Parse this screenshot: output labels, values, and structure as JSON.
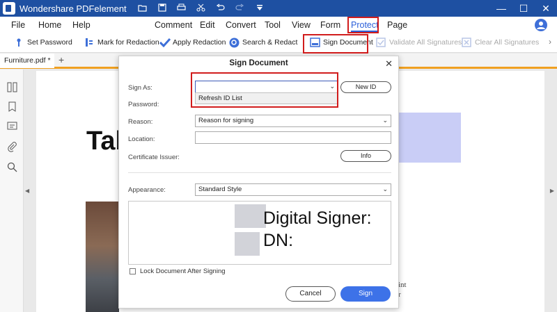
{
  "app": {
    "title": "Wondershare PDFelement"
  },
  "menu": {
    "file": "File",
    "home": "Home",
    "help": "Help",
    "comment": "Comment",
    "edit": "Edit",
    "convert": "Convert",
    "tool": "Tool",
    "view": "View",
    "form": "Form",
    "protect": "Protect",
    "page": "Page"
  },
  "toolbar": {
    "set_password": "Set Password",
    "mark_for_redaction": "Mark for Redaction",
    "apply_redaction": "Apply Redaction",
    "search_redact": "Search & Redact",
    "sign_document": "Sign Document",
    "validate_all": "Validate All Signatures",
    "clear_all": "Clear All Signatures"
  },
  "tab": {
    "name": "Furniture.pdf *",
    "add": "+"
  },
  "document": {
    "heading": "Tab",
    "text_line1": "int",
    "text_line2": "r"
  },
  "dialog": {
    "title": "Sign Document",
    "sign_as_label": "Sign As:",
    "sign_as_value": "",
    "dropdown_option": "Refresh ID List",
    "new_id": "New ID",
    "password_label": "Password:",
    "reason_label": "Reason:",
    "reason_value": "Reason for signing",
    "location_label": "Location:",
    "location_value": "",
    "cert_issuer_label": "Certificate Issuer:",
    "info": "Info",
    "appearance_label": "Appearance:",
    "appearance_value": "Standard Style",
    "preview_line1": "Digital Signer:",
    "preview_line2": "DN:",
    "lock_label": "Lock Document After Signing",
    "cancel": "Cancel",
    "sign": "Sign"
  },
  "colors": {
    "accent": "#3d72e8",
    "titlebar": "#1e50a2",
    "highlight": "#d11c1c",
    "tab_underline": "#f0a020"
  },
  "icons": [
    "app-logo-icon",
    "folder-icon",
    "save-icon",
    "print-icon",
    "scissors-icon",
    "undo-icon",
    "redo-icon",
    "dropdown-icon",
    "user-icon",
    "thumbnails-icon",
    "bookmark-icon",
    "comment-icon",
    "attachment-icon",
    "search-icon"
  ]
}
